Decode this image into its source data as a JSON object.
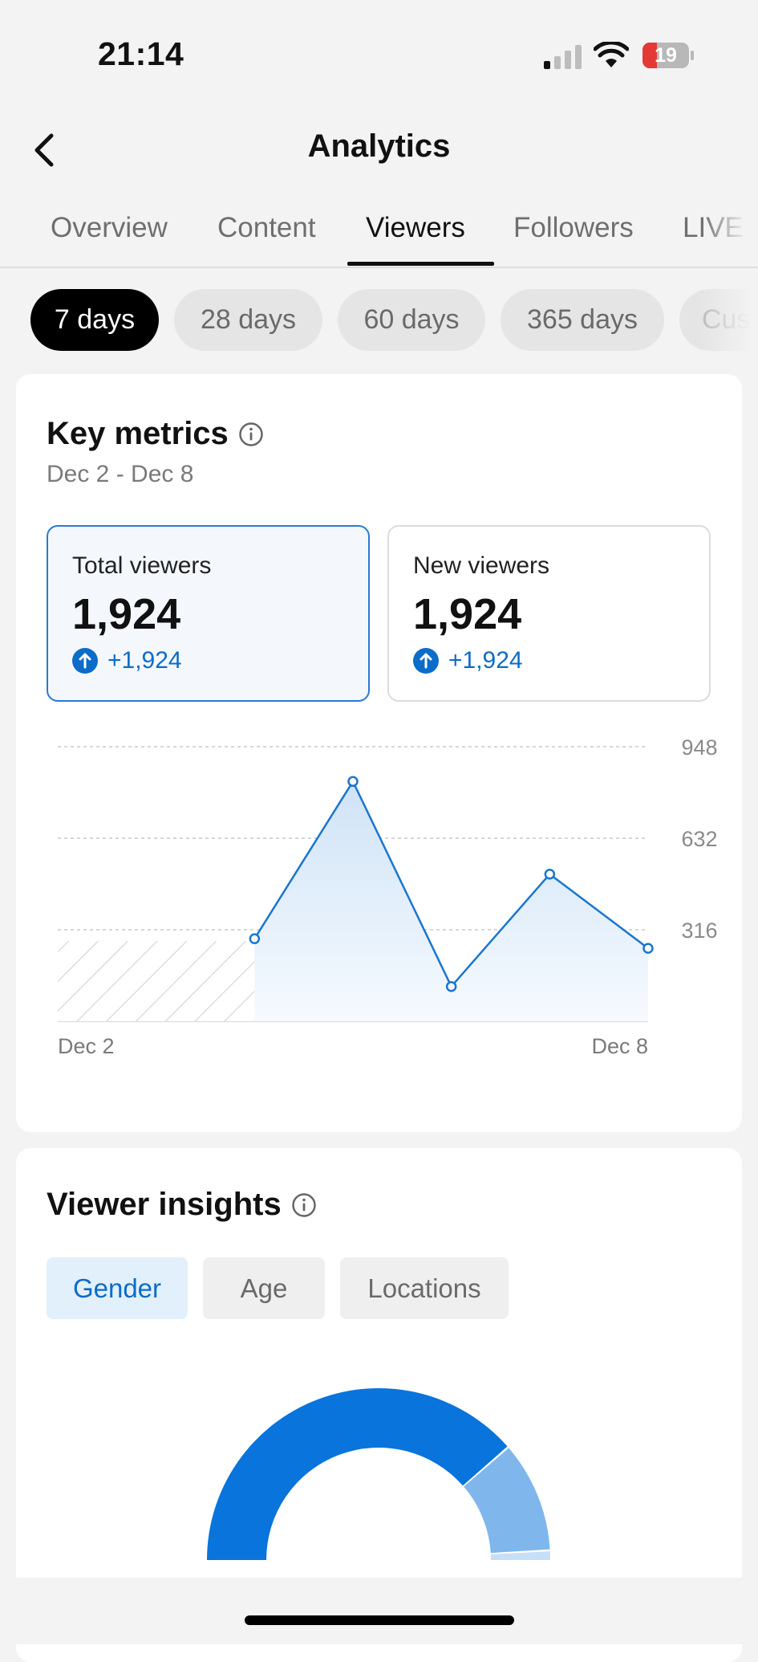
{
  "status_bar": {
    "time": "21:14",
    "battery_level": "19",
    "signal_icon": "cellular-signal-icon",
    "wifi_icon": "wifi-icon",
    "battery_icon": "battery-low-icon"
  },
  "nav": {
    "title": "Analytics",
    "back_icon": "chevron-left-icon"
  },
  "tabs": [
    {
      "label": "Overview",
      "active": false
    },
    {
      "label": "Content",
      "active": false
    },
    {
      "label": "Viewers",
      "active": true
    },
    {
      "label": "Followers",
      "active": false
    },
    {
      "label": "LIVE",
      "active": false
    }
  ],
  "date_ranges": [
    {
      "label": "7 days",
      "active": true
    },
    {
      "label": "28 days",
      "active": false
    },
    {
      "label": "60 days",
      "active": false
    },
    {
      "label": "365 days",
      "active": false
    },
    {
      "label": "Cus",
      "active": false
    }
  ],
  "key_metrics": {
    "title": "Key metrics",
    "date_range": "Dec 2 - Dec 8",
    "metrics": [
      {
        "label": "Total viewers",
        "value": "1,924",
        "change": "+1,924",
        "selected": true
      },
      {
        "label": "New viewers",
        "value": "1,924",
        "change": "+1,924",
        "selected": false
      }
    ]
  },
  "chart_data": {
    "type": "area",
    "title": "",
    "xlabel": "",
    "ylabel": "",
    "x": [
      "Dec 2",
      "Dec 3",
      "Dec 4",
      "Dec 5",
      "Dec 6",
      "Dec 7",
      "Dec 8"
    ],
    "x_tick_labels": [
      "Dec 2",
      "Dec 8"
    ],
    "y_ticks": [
      316,
      632,
      948
    ],
    "ylim": [
      0,
      948
    ],
    "series": [
      {
        "values": [
          null,
          null,
          285,
          828,
          120,
          508,
          252
        ]
      }
    ],
    "no_data_range": [
      "Dec 2",
      "Dec 4"
    ],
    "grid": true,
    "color": "#1a76cf"
  },
  "viewer_insights": {
    "title": "Viewer insights",
    "tabs": [
      {
        "label": "Gender",
        "active": true
      },
      {
        "label": "Age",
        "active": false
      },
      {
        "label": "Locations",
        "active": false
      }
    ],
    "gender_breakdown": {
      "type": "pie",
      "values": [
        77,
        21,
        2
      ],
      "colors": [
        "#0874dc",
        "#7fb7ec",
        "#c7dff6"
      ]
    }
  }
}
